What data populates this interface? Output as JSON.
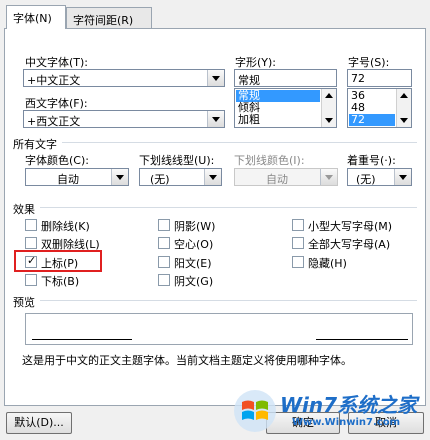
{
  "tabs": [
    {
      "label": "字体(N)"
    },
    {
      "label": "字符间距(R)"
    }
  ],
  "chinese_font": {
    "label": "中文字体(T):",
    "value": "+中文正文"
  },
  "western_font": {
    "label": "西文字体(F):",
    "value": "+西文正文"
  },
  "style": {
    "label": "字形(Y):",
    "value": "常规",
    "options": [
      "常规",
      "倾斜",
      "加粗"
    ],
    "selected": "常规"
  },
  "size": {
    "label": "字号(S):",
    "value": "72",
    "options": [
      "36",
      "48",
      "72"
    ],
    "selected": "72"
  },
  "all_text": {
    "title": "所有文字",
    "font_color": {
      "label": "字体颜色(C):",
      "value": "自动"
    },
    "underline_type": {
      "label": "下划线线型(U):",
      "value": "(无)"
    },
    "underline_color": {
      "label": "下划线颜色(I):",
      "value": "自动"
    },
    "emphasis": {
      "label": "着重号(·):",
      "value": "(无)"
    }
  },
  "effects": {
    "title": "效果",
    "items": [
      {
        "label": "删除线(K)",
        "checked": false
      },
      {
        "label": "双删除线(L)",
        "checked": false
      },
      {
        "label": "上标(P)",
        "checked": true
      },
      {
        "label": "下标(B)",
        "checked": false
      },
      {
        "label": "阴影(W)",
        "checked": false
      },
      {
        "label": "空心(O)",
        "checked": false
      },
      {
        "label": "阳文(E)",
        "checked": false
      },
      {
        "label": "阴文(G)",
        "checked": false
      },
      {
        "label": "小型大写字母(M)",
        "checked": false
      },
      {
        "label": "全部大写字母(A)",
        "checked": false
      },
      {
        "label": "隐藏(H)",
        "checked": false
      }
    ]
  },
  "preview": {
    "title": "预览",
    "note": "这是用于中文的正文主题字体。当前文档主题定义将使用哪种字体。"
  },
  "buttons": {
    "default": "默认(D)...",
    "ok": "确定",
    "cancel": "取消"
  },
  "watermark": {
    "brand": "Win7系统之家",
    "url": "Www.Winwin7.com"
  },
  "colors": {
    "accent": "#3399ff",
    "highlight": "#e02020"
  }
}
